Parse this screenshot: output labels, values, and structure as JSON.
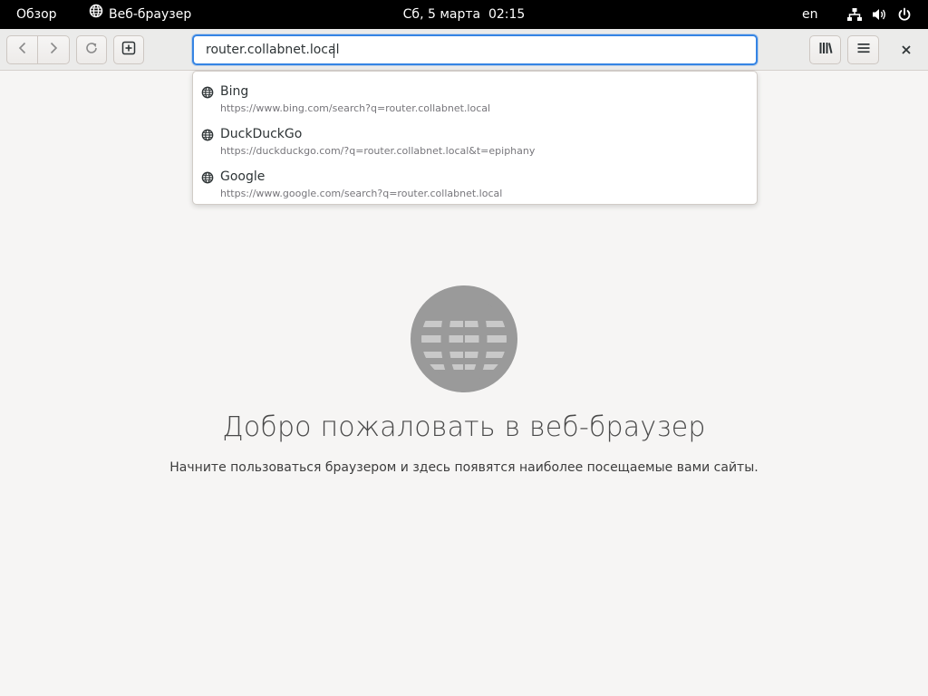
{
  "topbar": {
    "overview": "Обзор",
    "app_name": "Веб-браузер",
    "clock": "Сб, 5 марта  02:15",
    "language": "en"
  },
  "headerbar": {
    "url_value": "router.collabnet.local",
    "icons": {
      "back": "chevron-left-icon",
      "forward": "chevron-right-icon",
      "reload": "reload-icon",
      "new_tab": "new-tab-icon",
      "library": "library-icon",
      "menu": "hamburger-icon",
      "close": "close-icon"
    }
  },
  "suggestions": [
    {
      "title": "Bing",
      "url": "https://www.bing.com/search?q=router.collabnet.local"
    },
    {
      "title": "DuckDuckGo",
      "url": "https://duckduckgo.com/?q=router.collabnet.local&t=epiphany"
    },
    {
      "title": "Google",
      "url": "https://www.google.com/search?q=router.collabnet.local"
    }
  ],
  "welcome": {
    "title": "Добро пожаловать в веб-браузер",
    "subtitle": "Начните пользоваться браузером и здесь появятся наиболее посещаемые вами сайты."
  },
  "colors": {
    "accent": "#3584e4",
    "topbar_bg": "#000000",
    "page_bg": "#f6f5f4",
    "globe": "#9a9a9a"
  }
}
